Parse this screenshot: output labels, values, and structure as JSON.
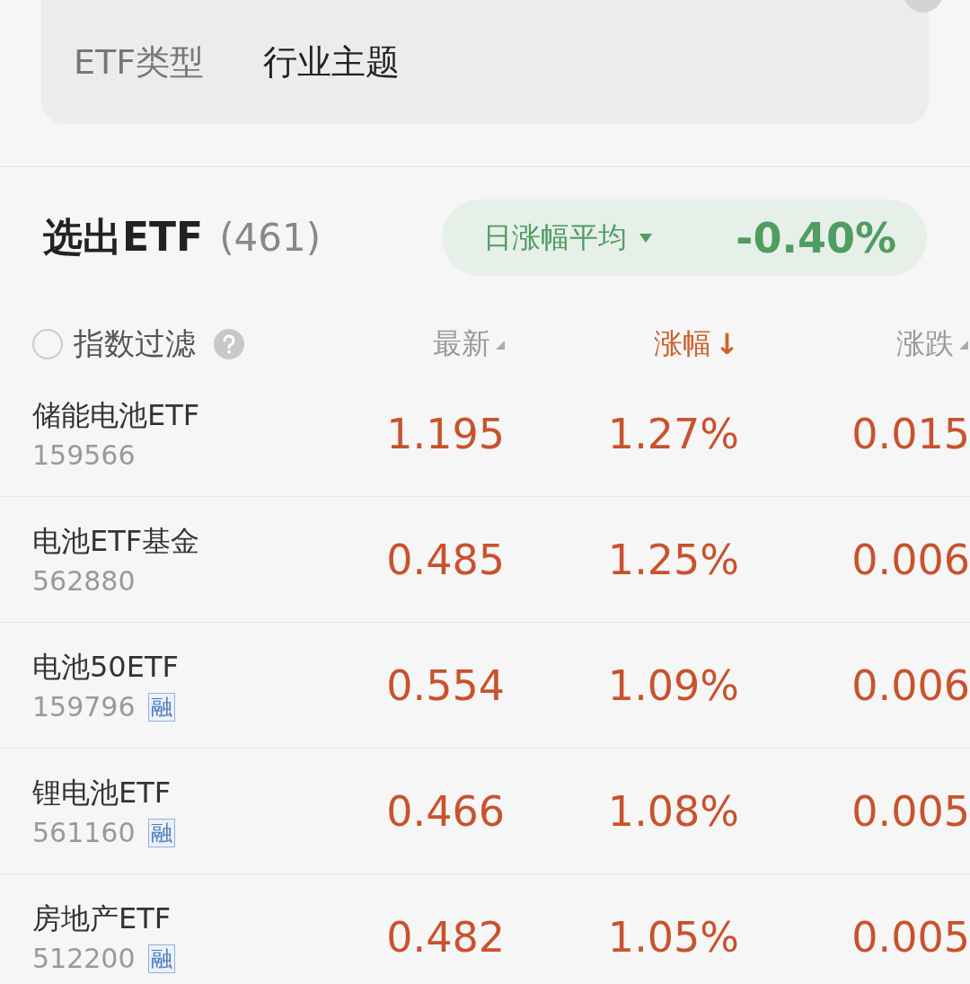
{
  "filter_tabs": [
    {
      "label": "ETF类型",
      "selected": false
    },
    {
      "label": "行业主题",
      "selected": true
    }
  ],
  "summary": {
    "title": "选出ETF",
    "count": "(461)",
    "metric_label": "日涨幅平均",
    "metric_value": "-0.40%"
  },
  "index_filter": {
    "label": "指数过滤",
    "checked": false
  },
  "columns": [
    {
      "label": "最新",
      "sorted": false
    },
    {
      "label": "涨幅",
      "sorted": true,
      "sort_mark": "↓"
    },
    {
      "label": "涨跌",
      "sorted": false
    }
  ],
  "rows": [
    {
      "name": "储能电池ETF",
      "code": "159566",
      "latest": "1.195",
      "change_pct": "1.27%",
      "change": "0.015"
    },
    {
      "name": "电池ETF基金",
      "code": "562880",
      "latest": "0.485",
      "change_pct": "1.25%",
      "change": "0.006"
    },
    {
      "name": "电池50ETF",
      "code": "159796",
      "badge": "融",
      "latest": "0.554",
      "change_pct": "1.09%",
      "change": "0.006"
    },
    {
      "name": "锂电池ETF",
      "code": "561160",
      "badge": "融",
      "latest": "0.466",
      "change_pct": "1.08%",
      "change": "0.005"
    },
    {
      "name": "房地产ETF",
      "code": "512200",
      "badge": "融",
      "latest": "0.482",
      "change_pct": "1.05%",
      "change": "0.005"
    }
  ]
}
